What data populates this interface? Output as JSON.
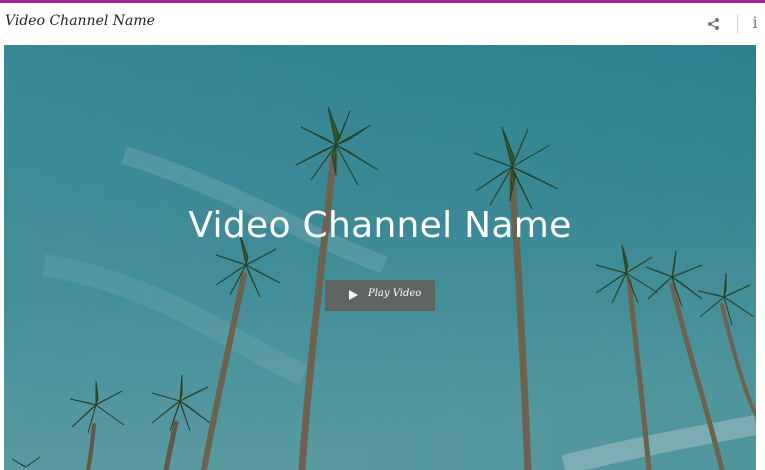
{
  "header": {
    "title": "Video Channel Name",
    "share_icon": "share-icon",
    "info_icon": "info-icon",
    "info_glyph": "i"
  },
  "hero": {
    "title": "Video Channel Name",
    "play_label": "Play Video",
    "play_icon": "play-icon"
  },
  "colors": {
    "accent_border": "#9c2a8d",
    "sky_top": "#2b8a9a",
    "sky_bottom": "#4a9ca5",
    "button_bg": "#62625c"
  }
}
